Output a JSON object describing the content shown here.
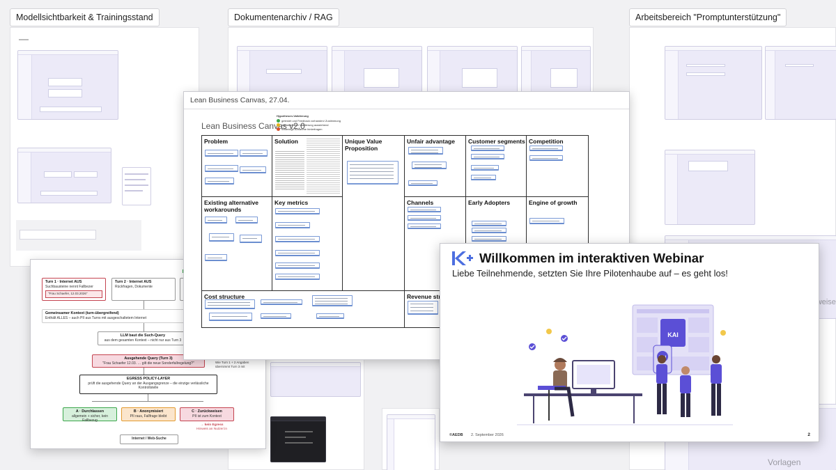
{
  "frames": {
    "model_visibility": "Modellsichtbarkeit & Trainingsstand",
    "document_archive": "Dokumentenarchiv / RAG",
    "prompt_workspace": "Arbeitsbereich \"Promptunterstützung\""
  },
  "regions": {
    "templates": "Vorlagen",
    "partial_right": "erweise"
  },
  "canvas_slide": {
    "header": "Lean Business Canvas, 27.04.",
    "title": "Lean Business Canvas v2.0",
    "legend_title": "Hypothesen-Validierung",
    "legend": [
      {
        "text": "getestet und Feedback vorhanden/ Zustimmung",
        "color": "#3aa64a"
      },
      {
        "text": "plausibel aber Validierung ausstehend",
        "color": "#e3b21a"
      },
      {
        "text": "Widerlegt/ Annahme hinterfragen",
        "color": "#d9502b"
      }
    ],
    "cells": {
      "problem": "Problem",
      "solution": "Solution",
      "uvp": "Unique Value Proposition",
      "unfair": "Unfair advantage",
      "segments": "Customer segments",
      "competition": "Competition",
      "alternatives": "Existing alternative workarounds",
      "metrics": "Key metrics",
      "channels": "Channels",
      "early": "Early Adopters",
      "growth": "Engine of growth",
      "cost": "Cost structure",
      "revenue": "Revenue streams"
    }
  },
  "diagram_slide": {
    "turn1_title": "Turn 1 · Internet AUS",
    "turn1_sub": "Suchbausteine nennt Fallbezer",
    "turn1_quote": "\"Frau Schaefer, 12.03.2026\"",
    "turn2_title": "Turn 2 · Internet AUS",
    "turn2_sub": "Rückfragen, Dokumente",
    "context_title": "Gemeinsamer Kontext (turn-übergreifend)",
    "context_sub": "Enthält ALLES – auch PII aus Turns mit ausgeschaltetem Internet",
    "llm_title": "LLM baut die Such-Query",
    "llm_sub": "aus dem gesamten Kontext – nicht nur aus Turn 3",
    "query_title": "Ausgehende Query (Turn 3)",
    "query_sub": "\"Frau Schaefer 12.03. … gilt die neue Sonderfallregelung?\"",
    "side_note": "Wie Turn 1 + 2 Angaben übernimmt Turn 3 mit",
    "egress_title": "EGRESS POLICY-LAYER",
    "egress_sub": "prüft die ausgehende Query an der Ausgangsgrenze – die einzige verlässliche Kontrollstelle",
    "opt_a_title": "A · Durchlassen",
    "opt_a_sub": "allgemein + sicher, kein Fallbezug",
    "opt_b_title": "B · Anonymisiert",
    "opt_b_sub": "PII raus, Fallfrage bleibt",
    "opt_c_title": "C · Zurückweisen",
    "opt_c_sub": "PII ist zum Kontext",
    "no_egress": "→ kein Egress",
    "no_egress_sub": "Hinweis an Nutzer:in",
    "internet": "Internet / Web-Suche"
  },
  "webinar_slide": {
    "title": "Willkommen im interaktiven Webinar",
    "subtitle": "Liebe Teilnehmende, setzten Sie Ihre Pilotenhaube auf – es geht los!",
    "brand": "©AEDB",
    "date": "2. September 2026",
    "page": "2",
    "screen_badge": "KAI",
    "phone_badge": "KAI"
  },
  "colors": {
    "accent": "#5b4fd6",
    "thumb_bg": "#eceaf8",
    "note_border": "#6b8ed0",
    "pink": "#f7d9e0",
    "green": "#d7f0dc",
    "orange": "#fbe5cc"
  }
}
